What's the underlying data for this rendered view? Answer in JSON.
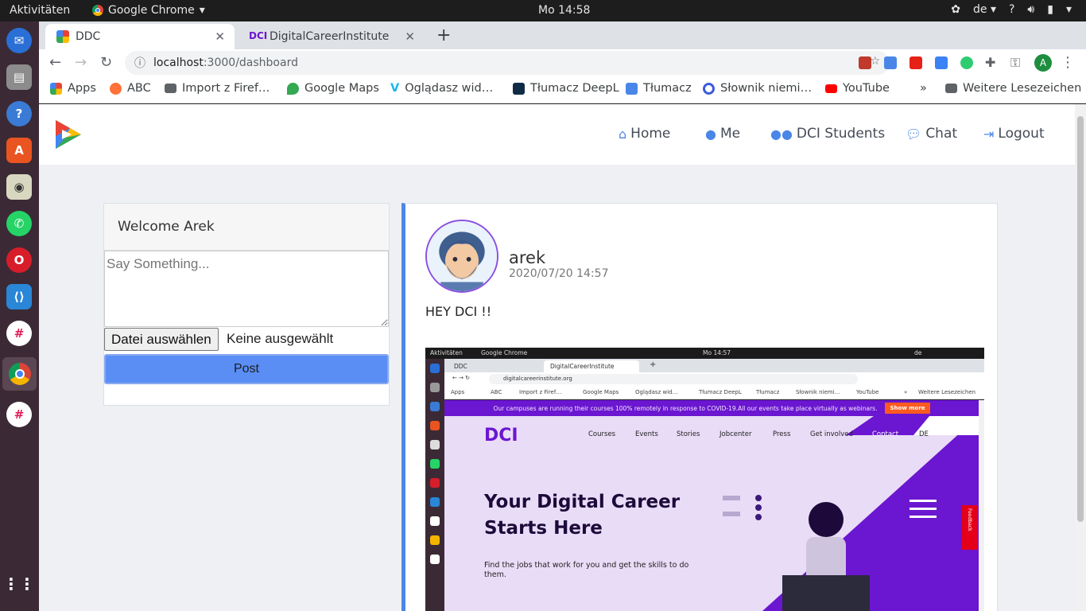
{
  "os": {
    "activities": "Aktivitäten",
    "app_name": "Google Chrome",
    "clock": "Mo 14:58",
    "lang": "de",
    "help": "?"
  },
  "browser": {
    "tabs": [
      {
        "title": "DDC",
        "active": true
      },
      {
        "title": "DigitalCareerInstitute",
        "active": false
      }
    ],
    "url_host": "localhost",
    "url_path": ":3000/dashboard",
    "profile_initial": "A",
    "bookmarks": [
      {
        "label": "Apps"
      },
      {
        "label": "ABC"
      },
      {
        "label": "Import z Firef…"
      },
      {
        "label": "Google Maps"
      },
      {
        "label": "Oglądasz wid…"
      },
      {
        "label": "Tłumacz DeepL"
      },
      {
        "label": "Tłumacz"
      },
      {
        "label": "Słownik niemi…"
      },
      {
        "label": "YouTube"
      },
      {
        "label": "»"
      },
      {
        "label": "Weitere Lesezeichen"
      }
    ]
  },
  "app": {
    "nav": [
      {
        "label": "Home",
        "icon": "home-icon"
      },
      {
        "label": "Me",
        "icon": "user-icon"
      },
      {
        "label": "DCI Students",
        "icon": "users-icon"
      },
      {
        "label": "Chat",
        "icon": "chat-icon"
      },
      {
        "label": "Logout",
        "icon": "logout-icon"
      }
    ],
    "composer": {
      "welcome": "Welcome Arek",
      "placeholder": "Say Something...",
      "file_button": "Datei auswählen",
      "file_status": "Keine ausgewählt",
      "post_button": "Post"
    },
    "post": {
      "username": "arek",
      "date": "2020/07/20 14:57",
      "text": "HEY DCI !!"
    }
  },
  "embedded_screenshot": {
    "top_left": "Aktivitäten",
    "app": "Google Chrome",
    "clock": "Mo 14:57",
    "lang": "de",
    "tabs": [
      "DDC",
      "DigitalCareerInstitute"
    ],
    "url": "digitalcareerinstitute.org",
    "bookmarks": [
      "Apps",
      "ABC",
      "Import z Firef…",
      "Google Maps",
      "Oglądasz wid…",
      "Tłumacz DeepL",
      "Tłumacz",
      "Słownik niemi…",
      "YouTube",
      "»",
      "Weitere Lesezeichen"
    ],
    "banner": "Our campuses are running their courses 100% remotely in response to COVID-19.All our events take place virtually as webinars.",
    "banner_button": "Show more",
    "logo": "DCI",
    "nav": [
      "Courses",
      "Events",
      "Stories",
      "Jobcenter",
      "Press",
      "Get involved",
      "Contact",
      "DE"
    ],
    "headline_1": "Your Digital Career",
    "headline_2": "Starts Here",
    "subtext": "Find the jobs that work for you and get the skills to do them.",
    "feedback": "Feedback"
  },
  "colors": {
    "accent": "#4a86e8",
    "post_button": "#5a8ef5",
    "dci_purple": "#6b16d0"
  }
}
